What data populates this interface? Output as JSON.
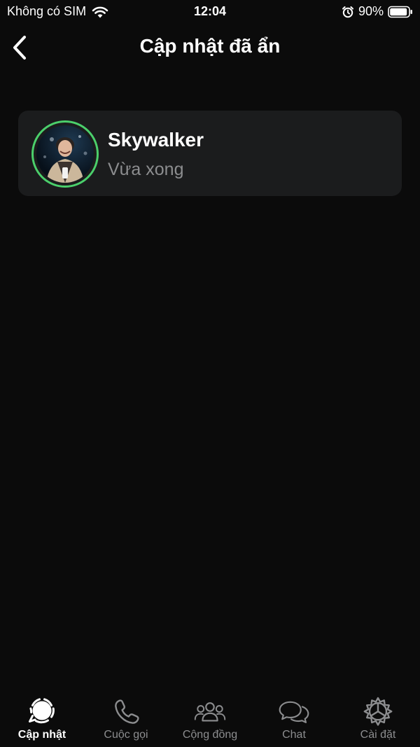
{
  "status_bar": {
    "carrier": "Không có SIM",
    "time": "12:04",
    "battery": "90%"
  },
  "header": {
    "title": "Cập nhật đã ẩn",
    "back_icon": "chevron-left-icon"
  },
  "updates": [
    {
      "name": "Skywalker",
      "time": "Vừa xong",
      "ring_color": "#4bcf6b"
    }
  ],
  "tabs": [
    {
      "label": "Cập nhật",
      "icon": "updates-icon",
      "active": true
    },
    {
      "label": "Cuộc gọi",
      "icon": "phone-icon",
      "active": false
    },
    {
      "label": "Cộng đồng",
      "icon": "community-icon",
      "active": false
    },
    {
      "label": "Chat",
      "icon": "chat-icon",
      "active": false
    },
    {
      "label": "Cài đặt",
      "icon": "gear-icon",
      "active": false
    }
  ],
  "colors": {
    "background": "#0b0b0b",
    "card": "#1b1c1d",
    "accent_green": "#4bcf6b",
    "muted_text": "#8c8d8f"
  }
}
